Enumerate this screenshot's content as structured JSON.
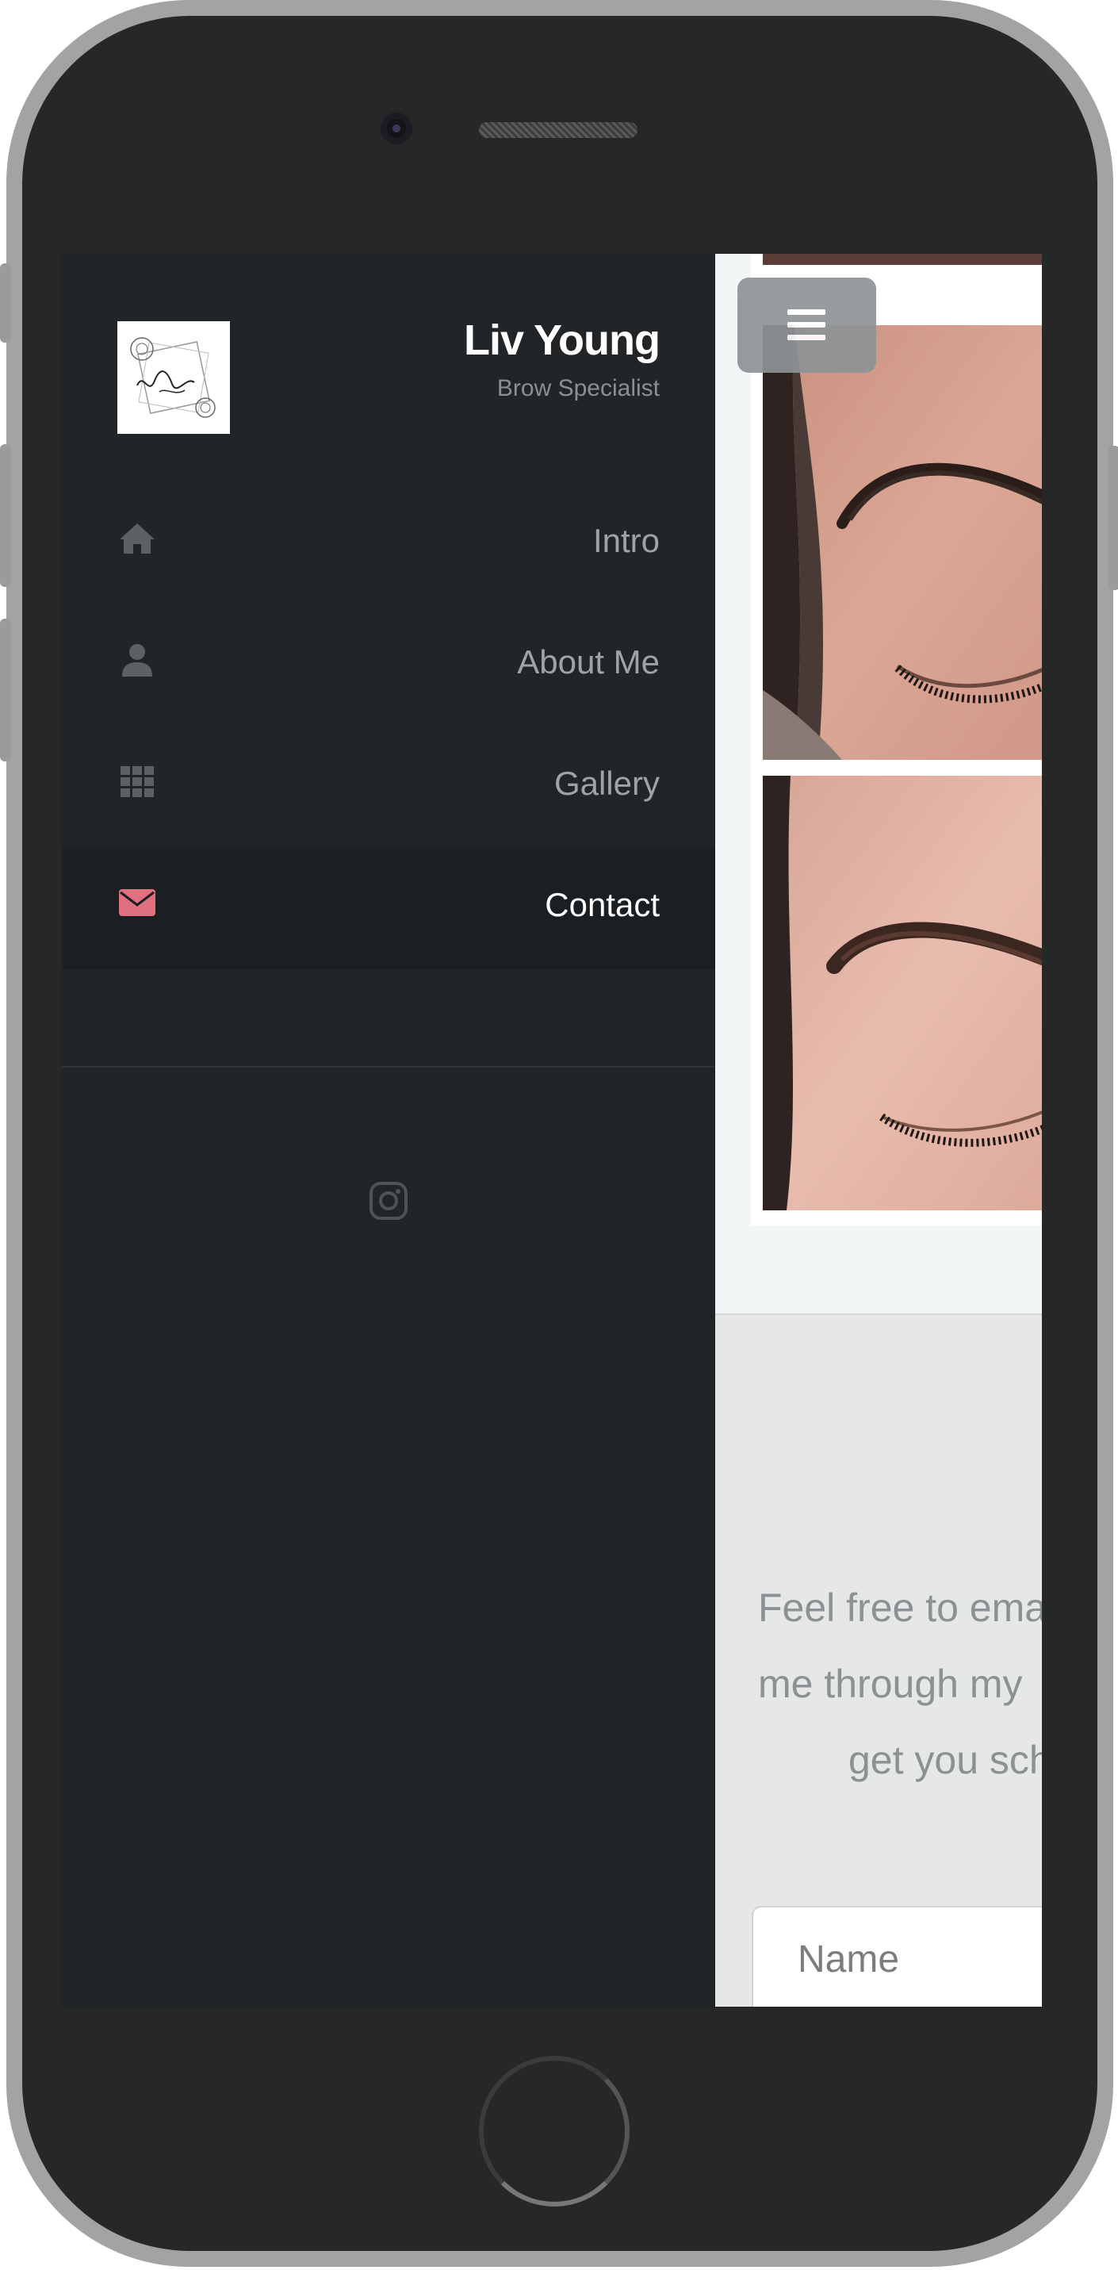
{
  "site": {
    "name": "Liv Young",
    "tagline": "Brow Specialist",
    "logo_alt": "Liv Young logo"
  },
  "nav": {
    "items": [
      {
        "label": "Intro",
        "icon": "home-icon",
        "active": false
      },
      {
        "label": "About Me",
        "icon": "user-icon",
        "active": false
      },
      {
        "label": "Gallery",
        "icon": "grid-icon",
        "active": false
      },
      {
        "label": "Contact",
        "icon": "envelope-icon",
        "active": true
      }
    ]
  },
  "social": {
    "icon": "instagram-icon"
  },
  "contact": {
    "lines": [
      "Feel free to ema",
      "me through my",
      "get you sch"
    ],
    "name_placeholder": "Name"
  },
  "colors": {
    "sidebar_bg": "#212528",
    "active_item_bg": "#1b1f22",
    "accent": "#e0707f",
    "nav_text": "#9ea3a7"
  }
}
